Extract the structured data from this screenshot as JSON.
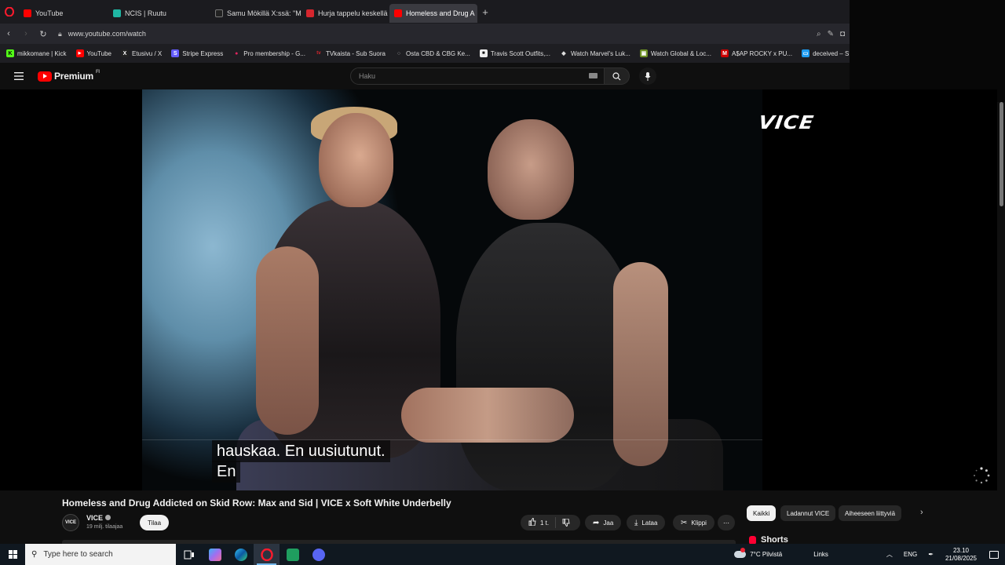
{
  "browser": {
    "tabs": [
      {
        "label": "YouTube",
        "color": "#ff0000"
      },
      {
        "label": "NCIS | Ruutu",
        "color": "#1fb6a3"
      },
      {
        "label": "Samu Mökillä X:ssä: \"Mini",
        "color": "#222222"
      },
      {
        "label": "Hurja tappelu keskellä He",
        "color": "#d6262e"
      },
      {
        "label": "Homeless and Drug A",
        "color": "#ff0000"
      }
    ],
    "url": "www.youtube.com/watch",
    "bookmarks": [
      {
        "label": "mikkomane | Kick",
        "color": "#53fc18",
        "glyph": "K"
      },
      {
        "label": "YouTube",
        "color": "#ff0000",
        "glyph": "▶"
      },
      {
        "label": "Etusivu / X",
        "color": "#222222",
        "glyph": "X"
      },
      {
        "label": "Stripe Express",
        "color": "#635bff",
        "glyph": "S"
      },
      {
        "label": "Pro membership - G...",
        "color": "#e0245e",
        "glyph": "●"
      },
      {
        "label": "TVkaista - Sub Suora",
        "color": "#d6262e",
        "glyph": "tv"
      },
      {
        "label": "Osta CBD & CBG Ke...",
        "color": "#444444",
        "glyph": "○"
      },
      {
        "label": "Travis Scott Outfits,...",
        "color": "#eeeeee",
        "glyph": "■"
      },
      {
        "label": "Watch Marvel's Luk...",
        "color": "#333333",
        "glyph": "◆"
      },
      {
        "label": "Watch Global & Loc...",
        "color": "#6b8e23",
        "glyph": "▣"
      },
      {
        "label": "A$AP ROCKY x PU...",
        "color": "#cc0000",
        "glyph": "M"
      },
      {
        "label": "deceived – SUORAT...",
        "color": "#1d9bf0",
        "glyph": "▭"
      }
    ]
  },
  "youtube": {
    "logo_text": "Premium",
    "country": "FI",
    "search_placeholder": "Haku"
  },
  "video": {
    "watermark": "VICE",
    "caption_line1": "hauskaa.  En uusiutunut.",
    "caption_line2": "En",
    "title": "Homeless and Drug Addicted on Skid Row: Max and Sid | VICE x Soft White Underbelly",
    "channel": "VICE",
    "subscribers": "19 milj. tilaajaa",
    "subscribe_label": "Tilaa",
    "likes": "1 t.",
    "share_label": "Jaa",
    "download_label": "Lataa",
    "clip_label": "Klippi"
  },
  "chips": {
    "all": "Kaikki",
    "from_channel": "Ladannut VICE",
    "related": "Aiheeseen liittyviä"
  },
  "shorts_label": "Shorts",
  "taskbar": {
    "search_placeholder": "Type here to search",
    "weather": "7°C  Pilvistä",
    "links": "Links",
    "lang": "ENG",
    "time": "23.10",
    "date": "21/08/2025"
  }
}
